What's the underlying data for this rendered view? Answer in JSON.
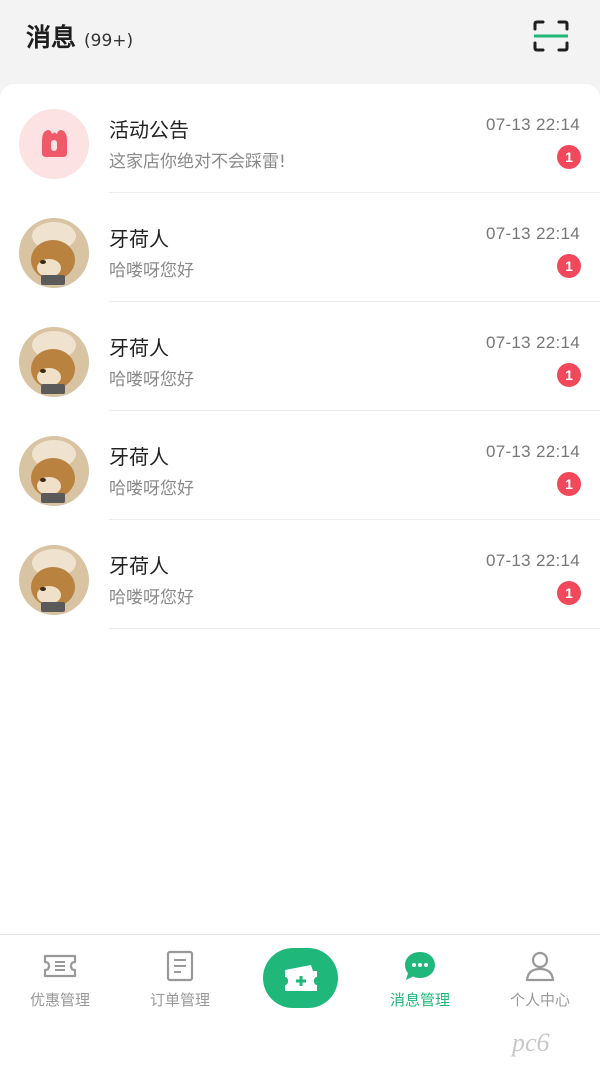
{
  "header": {
    "title": "消息",
    "count": "(99+)"
  },
  "messages": [
    {
      "name": "活动公告",
      "preview": "这家店你绝对不会踩雷!",
      "time": "07-13 22:14",
      "badge": "1",
      "avatar": "announcement-avatar"
    },
    {
      "name": "牙荷人",
      "preview": "哈喽呀您好",
      "time": "07-13 22:14",
      "badge": "1",
      "avatar": "dog-avatar"
    },
    {
      "name": "牙荷人",
      "preview": "哈喽呀您好",
      "time": "07-13 22:14",
      "badge": "1",
      "avatar": "dog-avatar"
    },
    {
      "name": "牙荷人",
      "preview": "哈喽呀您好",
      "time": "07-13 22:14",
      "badge": "1",
      "avatar": "dog-avatar"
    },
    {
      "name": "牙荷人",
      "preview": "哈喽呀您好",
      "time": "07-13 22:14",
      "badge": "1",
      "avatar": "dog-avatar"
    }
  ],
  "tabbar": {
    "tabs": [
      {
        "label": "优惠管理",
        "icon": "coupon-icon"
      },
      {
        "label": "订单管理",
        "icon": "order-icon"
      },
      {
        "label": "",
        "icon": "add-ticket-icon"
      },
      {
        "label": "消息管理",
        "icon": "message-icon",
        "active": true
      },
      {
        "label": "个人中心",
        "icon": "person-icon"
      }
    ]
  },
  "colors": {
    "accent": "#1fb87a",
    "badge": "#f2485b",
    "background": "#f3f3f4"
  },
  "watermark": "pc6"
}
